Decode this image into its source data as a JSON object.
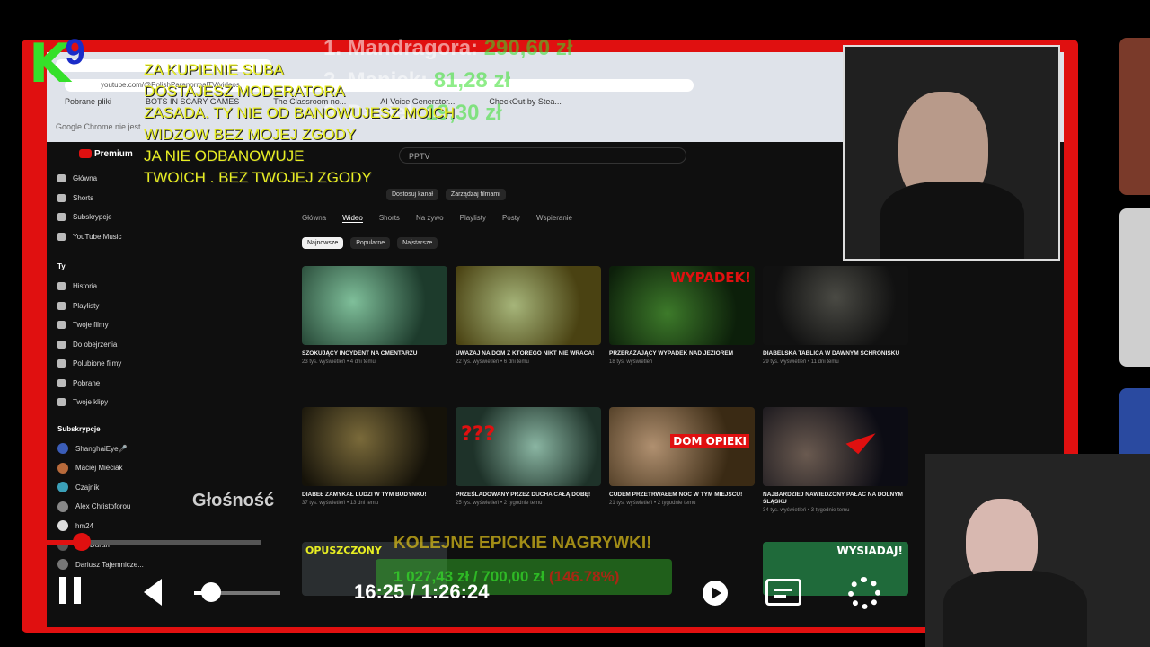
{
  "browser": {
    "url": "youtube.com/@PolishParanormalTV/videos",
    "bookmarks": [
      "Pobrane pliki",
      "BOTS IN SCARY GAMES",
      "The Classroom no...",
      "AI Voice Generator...",
      "CheckOut by Stea..."
    ],
    "chrome_hint": "Google Chrome nie jest..."
  },
  "youtube": {
    "logo_label": "Premium",
    "search_text": "PPTV",
    "sidebar_main": [
      "Główna",
      "Shorts",
      "Subskrypcje",
      "YouTube Music"
    ],
    "you_header": "Ty",
    "sidebar_you": [
      "Historia",
      "Playlisty",
      "Twoje filmy",
      "Do obejrzenia",
      "Polubione filmy",
      "Pobrane",
      "Twoje klipy"
    ],
    "subs_header": "Subskrypcje",
    "subscriptions": [
      "ShanghaiEye🎤",
      "Maciej Mieciak",
      "Czajnik",
      "Alex Christoforou",
      "hm24",
      "The Duran",
      "Dariusz Tajemnicze..."
    ],
    "channel_tabs": [
      "Główna",
      "Wideo",
      "Shorts",
      "Na żywo",
      "Playlisty",
      "Posty",
      "Wspieranie"
    ],
    "channel_buttons": [
      "Dostosuj kanał",
      "Zarządzaj filmami"
    ],
    "filters": [
      "Najnowsze",
      "Popularne",
      "Najstarsze"
    ],
    "videos": [
      {
        "title": "SZOKUJĄCY INCYDENT NA CMENTARZU",
        "meta": "23 tys. wyświetleń • 4 dni temu",
        "duration": "44:08",
        "overlay": ""
      },
      {
        "title": "UWAŻAJ NA DOM Z KTÓREGO NIKT NIE WRACA!",
        "meta": "22 tys. wyświetleń • 6 dni temu",
        "duration": "37:34",
        "overlay": ""
      },
      {
        "title": "PRZERAŻAJĄCY WYPADEK NAD JEZIOREM",
        "meta": "18 tys. wyświetleń",
        "duration": "29:06",
        "overlay": "WYPADEK!"
      },
      {
        "title": "DIABELSKA TABLICA W DAWNYM SCHRONISKU",
        "meta": "29 tys. wyświetleń • 11 dni temu",
        "duration": "",
        "overlay": ""
      },
      {
        "title": "DIABEŁ ZAMYKAŁ LUDZI W TYM BUDYNKU!",
        "meta": "37 tys. wyświetleń • 13 dni temu",
        "duration": "46:22",
        "overlay": ""
      },
      {
        "title": "PRZEŚLADOWANY PRZEZ DUCHA CAŁĄ DOBĘ!",
        "meta": "25 tys. wyświetleń • 2 tygodnie temu",
        "duration": "38:40",
        "overlay": "???"
      },
      {
        "title": "CUDEM PRZETRWAŁEM NOC W TYM MIEJSCU!",
        "meta": "21 tys. wyświetleń • 2 tygodnie temu",
        "duration": "39:02",
        "overlay": "DOM OPIEKI"
      },
      {
        "title": "NAJBARDZIEJ NAWIEDZONY PAŁAC NA DOLNYM ŚLĄSKU",
        "meta": "34 tys. wyświetleń • 3 tygodnie temu",
        "duration": "43:47",
        "overlay": ""
      }
    ],
    "next_row_overlays": [
      "OPUSZCZONY",
      "WYSIADAJ!"
    ]
  },
  "stream": {
    "logo_k": "K",
    "logo_9": "9",
    "rules_lines": [
      "ZA KUPIENIE SUBA",
      "DOSTAJESZ MODERATORA",
      "ZASADA. TY NIE OD BANOWUJESZ MOICH",
      "WIDZOW BEZ MOJEJ ZGODY",
      "JA NIE ODBANOWUJE",
      "TWOICH . BEZ TWOJEJ ZGODY"
    ],
    "ranking": [
      {
        "name": "1. Mandragora:",
        "amount": "290,60 zł"
      },
      {
        "name": "2. Maniek:",
        "amount": "81,28 zł"
      },
      {
        "name": "3. Daniel:",
        "amount": "19,30 zł"
      }
    ],
    "goal_title": "KOLEJNE EPICKIE NAGRYWKI!",
    "goal_amount": "1 027,43 zł / 700,00 zł",
    "goal_percent": "(146.78%)"
  },
  "player": {
    "volume_label": "Głośność",
    "timecode": "16:25 / 1:26:24",
    "progress_fraction": 0.19,
    "volume_fraction": 0.2
  },
  "colors": {
    "frame": "#e01010",
    "green": "#35e02a",
    "yellow": "#e8ee22"
  }
}
